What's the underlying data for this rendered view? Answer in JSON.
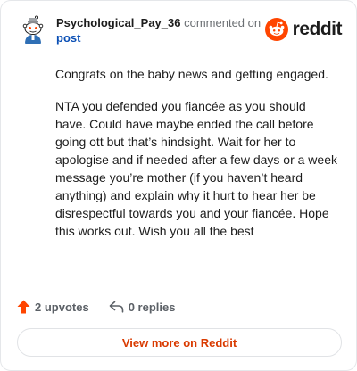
{
  "comment": {
    "username": "Psychological_Pay_36",
    "action_text": "commented on",
    "link_text": "post",
    "paragraphs": [
      "Congrats on the baby news and getting engaged.",
      "NTA you defended you fiancée as you should have. Could have maybe ended the call before going ott but that’s hindsight. Wait for her to apologise and if needed after a few days or a week message you’re mother (if you haven’t heard anything) and explain why it hurt to hear her be disrespectful towards you and your fiancée. Hope this works out. Wish you all the best"
    ]
  },
  "brand": {
    "name": "reddit",
    "color": "#ff4500"
  },
  "actions": {
    "upvotes": "2 upvotes",
    "replies": "0 replies"
  },
  "footer": {
    "view_more": "View more on Reddit"
  },
  "icons": {
    "upvote": "upvote-arrow-icon",
    "reply": "reply-arrow-icon",
    "logo": "reddit-snoo-icon",
    "avatar": "snoo-avatar-icon"
  },
  "colors": {
    "upvote": "#ff4500",
    "link": "#0a4fb5",
    "view_more": "#d93a00"
  }
}
